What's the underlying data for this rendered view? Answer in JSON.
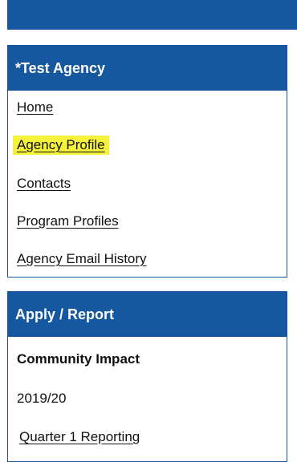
{
  "agency_panel": {
    "title": "*Test Agency",
    "items": [
      {
        "label": "Home"
      },
      {
        "label": "Agency Profile",
        "highlighted": true
      },
      {
        "label": "Contacts"
      },
      {
        "label": "Program Profiles"
      },
      {
        "label": "Agency Email History"
      }
    ]
  },
  "apply_panel": {
    "title": "Apply / Report",
    "section_heading": "Community Impact",
    "year": "2019/20",
    "link": "Quarter 1 Reporting"
  },
  "colors": {
    "header_blue": "#1558a0",
    "highlight_yellow": "#f6f23c"
  }
}
